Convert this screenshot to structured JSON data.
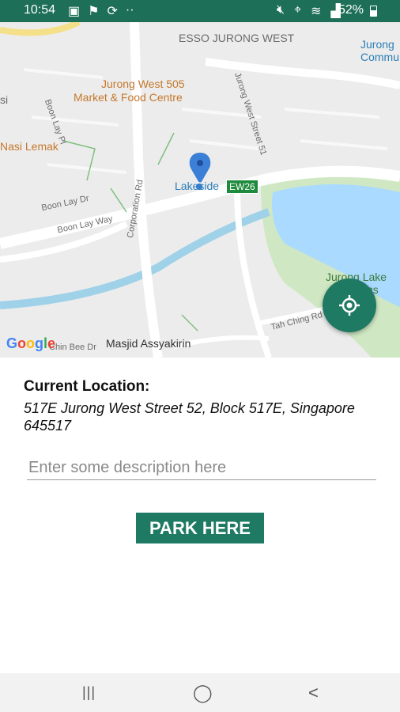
{
  "status_bar": {
    "time": "10:54",
    "battery": "52%"
  },
  "map": {
    "labels": {
      "esso": "ESSO JURONG WEST",
      "jurong_comm": "Jurong\nCommu",
      "market_line1": "Jurong West 505",
      "market_line2": "Market & Food Centre",
      "nasi": "Nasi Lemak",
      "lakeside": "Lakeside",
      "station_code": "EW26",
      "boon_lay_dr": "Boon Lay Dr",
      "boon_lay_way": "Boon Lay Way",
      "boon_lay_pl": "Boon Lay Pl",
      "corporation_rd": "Corporation Rd",
      "jw_st51": "Jurong West Street 51",
      "lake_gardens_line1": "Jurong Lake",
      "lake_gardens_line2": "Gardens",
      "tah_ching": "Tah Ching Rd",
      "masjid": "Masjid Assyakirin",
      "chin_bee": "Chin Bee Dr",
      "si": "si"
    },
    "google_logo": [
      "G",
      "o",
      "o",
      "g",
      "l",
      "e"
    ],
    "colors": {
      "park": "#cfe8c3",
      "water": "#aadaff",
      "road": "#ffffff",
      "canal": "#9fd1e8",
      "pin": "#3b7fd6"
    }
  },
  "location": {
    "heading": "Current Location:",
    "address": "517E Jurong West Street 52, Block 517E, Singapore 645517"
  },
  "description_input": {
    "placeholder": "Enter some description here",
    "value": ""
  },
  "park_button": {
    "label": "PARK HERE"
  },
  "nav_bar": {
    "recents": "|||",
    "home": "◯",
    "back": "<"
  },
  "theme": {
    "primary": "#1e7a63",
    "status_bar": "#1e6f57"
  }
}
